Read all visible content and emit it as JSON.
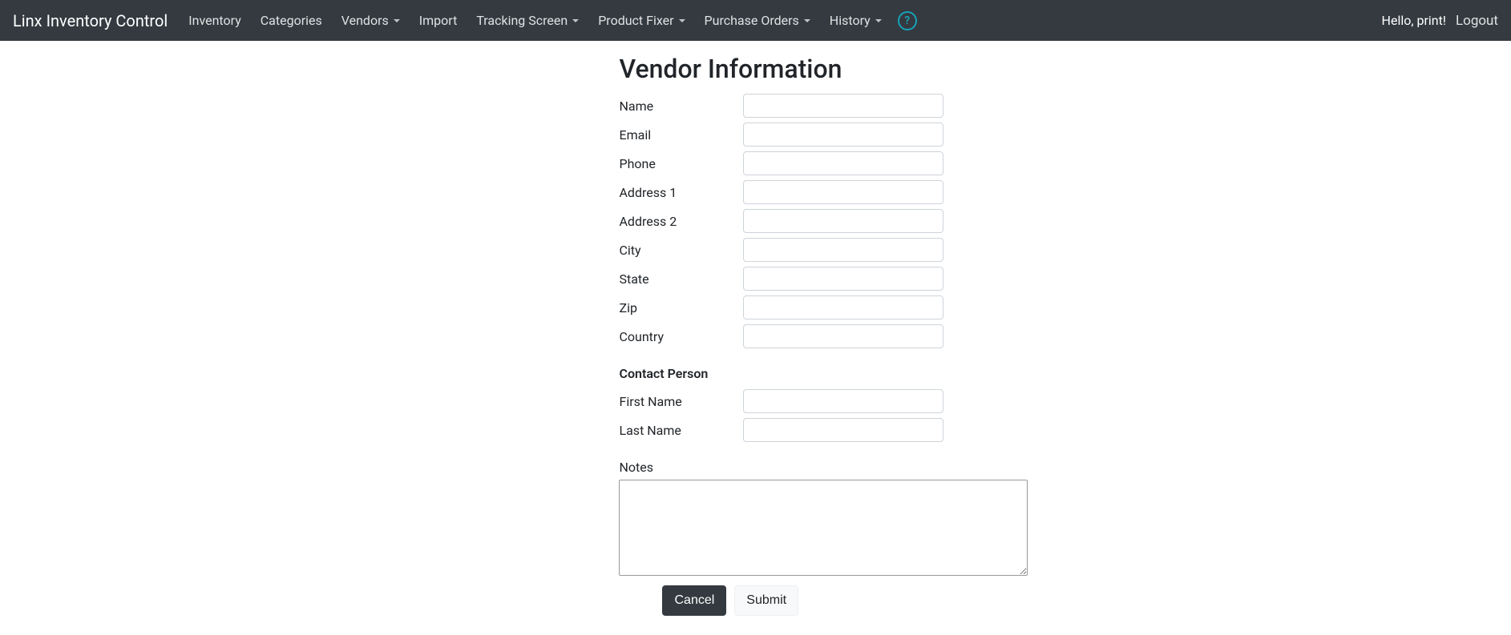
{
  "navbar": {
    "brand": "Linx Inventory Control",
    "items": [
      {
        "label": "Inventory",
        "dropdown": false
      },
      {
        "label": "Categories",
        "dropdown": false
      },
      {
        "label": "Vendors",
        "dropdown": true
      },
      {
        "label": "Import",
        "dropdown": false
      },
      {
        "label": "Tracking Screen",
        "dropdown": true
      },
      {
        "label": "Product Fixer",
        "dropdown": true
      },
      {
        "label": "Purchase Orders",
        "dropdown": true
      },
      {
        "label": "History",
        "dropdown": true
      }
    ],
    "help_glyph": "?",
    "greeting": "Hello, print!",
    "logout": "Logout"
  },
  "page": {
    "title": "Vendor Information",
    "fields": {
      "name": {
        "label": "Name",
        "value": ""
      },
      "email": {
        "label": "Email",
        "value": ""
      },
      "phone": {
        "label": "Phone",
        "value": ""
      },
      "address1": {
        "label": "Address 1",
        "value": ""
      },
      "address2": {
        "label": "Address 2",
        "value": ""
      },
      "city": {
        "label": "City",
        "value": ""
      },
      "state": {
        "label": "State",
        "value": ""
      },
      "zip": {
        "label": "Zip",
        "value": ""
      },
      "country": {
        "label": "Country",
        "value": ""
      }
    },
    "contact": {
      "heading": "Contact Person",
      "first_name": {
        "label": "First Name",
        "value": ""
      },
      "last_name": {
        "label": "Last Name",
        "value": ""
      }
    },
    "notes": {
      "label": "Notes",
      "value": ""
    },
    "buttons": {
      "cancel": "Cancel",
      "submit": "Submit"
    }
  }
}
